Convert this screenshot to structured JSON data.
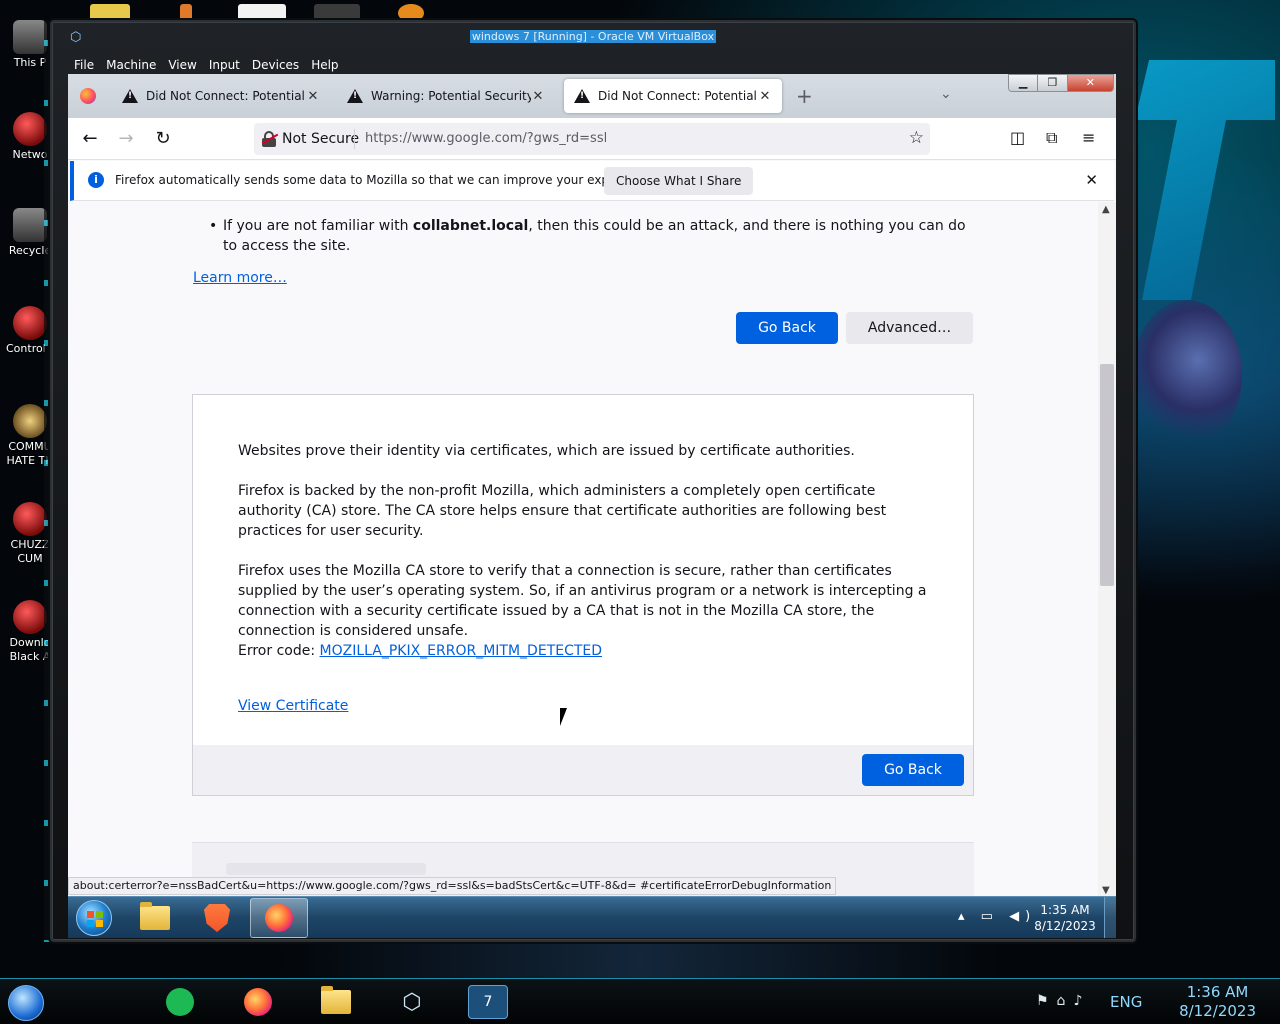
{
  "host": {
    "desktop_icons": [
      {
        "label": "This P",
        "icon": "computer-icon"
      },
      {
        "label": "Netwo",
        "icon": "network-icon"
      },
      {
        "label": "Recycle",
        "icon": "recycle-bin-icon"
      },
      {
        "label": "Control P",
        "icon": "control-panel-icon"
      },
      {
        "label": "COMMU",
        "label2": "HATE TH",
        "icon": "money-bag-icon"
      },
      {
        "label": "CHUZZ",
        "label2": "CUM",
        "icon": "skull-icon"
      },
      {
        "label": "Downlo",
        "label2": "Black A",
        "icon": "download-icon"
      }
    ],
    "taskbar": {
      "language": "ENG",
      "time": "1:36 AM",
      "date": "8/12/2023"
    }
  },
  "vm": {
    "title": "windows 7 [Running] - Oracle VM VirtualBox",
    "menu": [
      "File",
      "Machine",
      "View",
      "Input",
      "Devices",
      "Help"
    ]
  },
  "browser": {
    "tabs": [
      {
        "label": "Did Not Connect: Potential Sec",
        "active": false
      },
      {
        "label": "Warning: Potential Security Risk",
        "active": false
      },
      {
        "label": "Did Not Connect: Potential Sec",
        "active": true
      }
    ],
    "urlbar": {
      "security_label": "Not Secure",
      "url": "https://www.google.com/?gws_rd=ssl"
    },
    "notification": {
      "text": "Firefox automatically sends some data to Mozilla so that we can improve your experience.",
      "button": "Choose What I Share"
    },
    "status_link": "about:certerror?e=nssBadCert&u=https://www.google.com/?gws_rd=ssl&s=badStsCert&c=UTF-8&d= #certificateErrorDebugInformation"
  },
  "page": {
    "bullet_prefix": "If you are not familiar with ",
    "bullet_bold": "collabnet.local",
    "bullet_suffix": ", then this could be an attack, and there is nothing you can do to access the site.",
    "learn_more": "Learn more…",
    "go_back": "Go Back",
    "advanced": "Advanced…",
    "advanced_panel": {
      "p1": "Websites prove their identity via certificates, which are issued by certificate authorities.",
      "p2": "Firefox is backed by the non-profit Mozilla, which administers a completely open certificate authority (CA) store. The CA store helps ensure that certificate authorities are following best practices for user security.",
      "p3": "Firefox uses the Mozilla CA store to verify that a connection is secure, rather than certificates supplied by the user’s operating system. So, if an antivirus program or a network is intercepting a connection with a security certificate issued by a CA that is not in the Mozilla CA store, the connection is considered unsafe.",
      "error_prefix": "Error code: ",
      "error_code": "MOZILLA_PKIX_ERROR_MITM_DETECTED",
      "view_certificate": "View Certificate",
      "go_back": "Go Back"
    }
  },
  "guest_taskbar": {
    "time": "1:35 AM",
    "date": "8/12/2023"
  },
  "colors": {
    "accent_blue": "#0061e0",
    "link_blue": "#0060df",
    "vm_title_highlight": "#2a8fd8"
  }
}
